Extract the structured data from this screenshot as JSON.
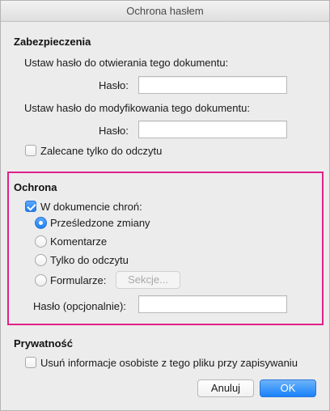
{
  "window": {
    "title": "Ochrona hasłem"
  },
  "security": {
    "heading": "Zabezpieczenia",
    "open_password_label": "Ustaw hasło do otwierania tego dokumentu:",
    "open_password_field_label": "Hasło:",
    "open_password_value": "",
    "modify_password_label": "Ustaw hasło do modyfikowania tego dokumentu:",
    "modify_password_field_label": "Hasło:",
    "modify_password_value": "",
    "read_only_recommended_label": "Zalecane tylko do odczytu",
    "read_only_recommended_checked": false
  },
  "protection": {
    "heading": "Ochrona",
    "protect_label": "W dokumencie chroń:",
    "protect_checked": true,
    "options": [
      {
        "label": "Prześledzone zmiany",
        "selected": true
      },
      {
        "label": "Komentarze",
        "selected": false
      },
      {
        "label": "Tylko do odczytu",
        "selected": false
      },
      {
        "label": "Formularze:",
        "selected": false
      }
    ],
    "sections_button": "Sekcje...",
    "optional_password_label": "Hasło (opcjonalnie):",
    "optional_password_value": "",
    "highlight_color": "#e0218a"
  },
  "privacy": {
    "heading": "Prywatność",
    "remove_personal_info_label": "Usuń informacje osobiste z tego pliku przy zapisywaniu",
    "remove_personal_info_checked": false
  },
  "buttons": {
    "cancel": "Anuluj",
    "ok": "OK"
  },
  "colors": {
    "accent": "#1f7ff0",
    "dialog_background": "#ececec"
  }
}
